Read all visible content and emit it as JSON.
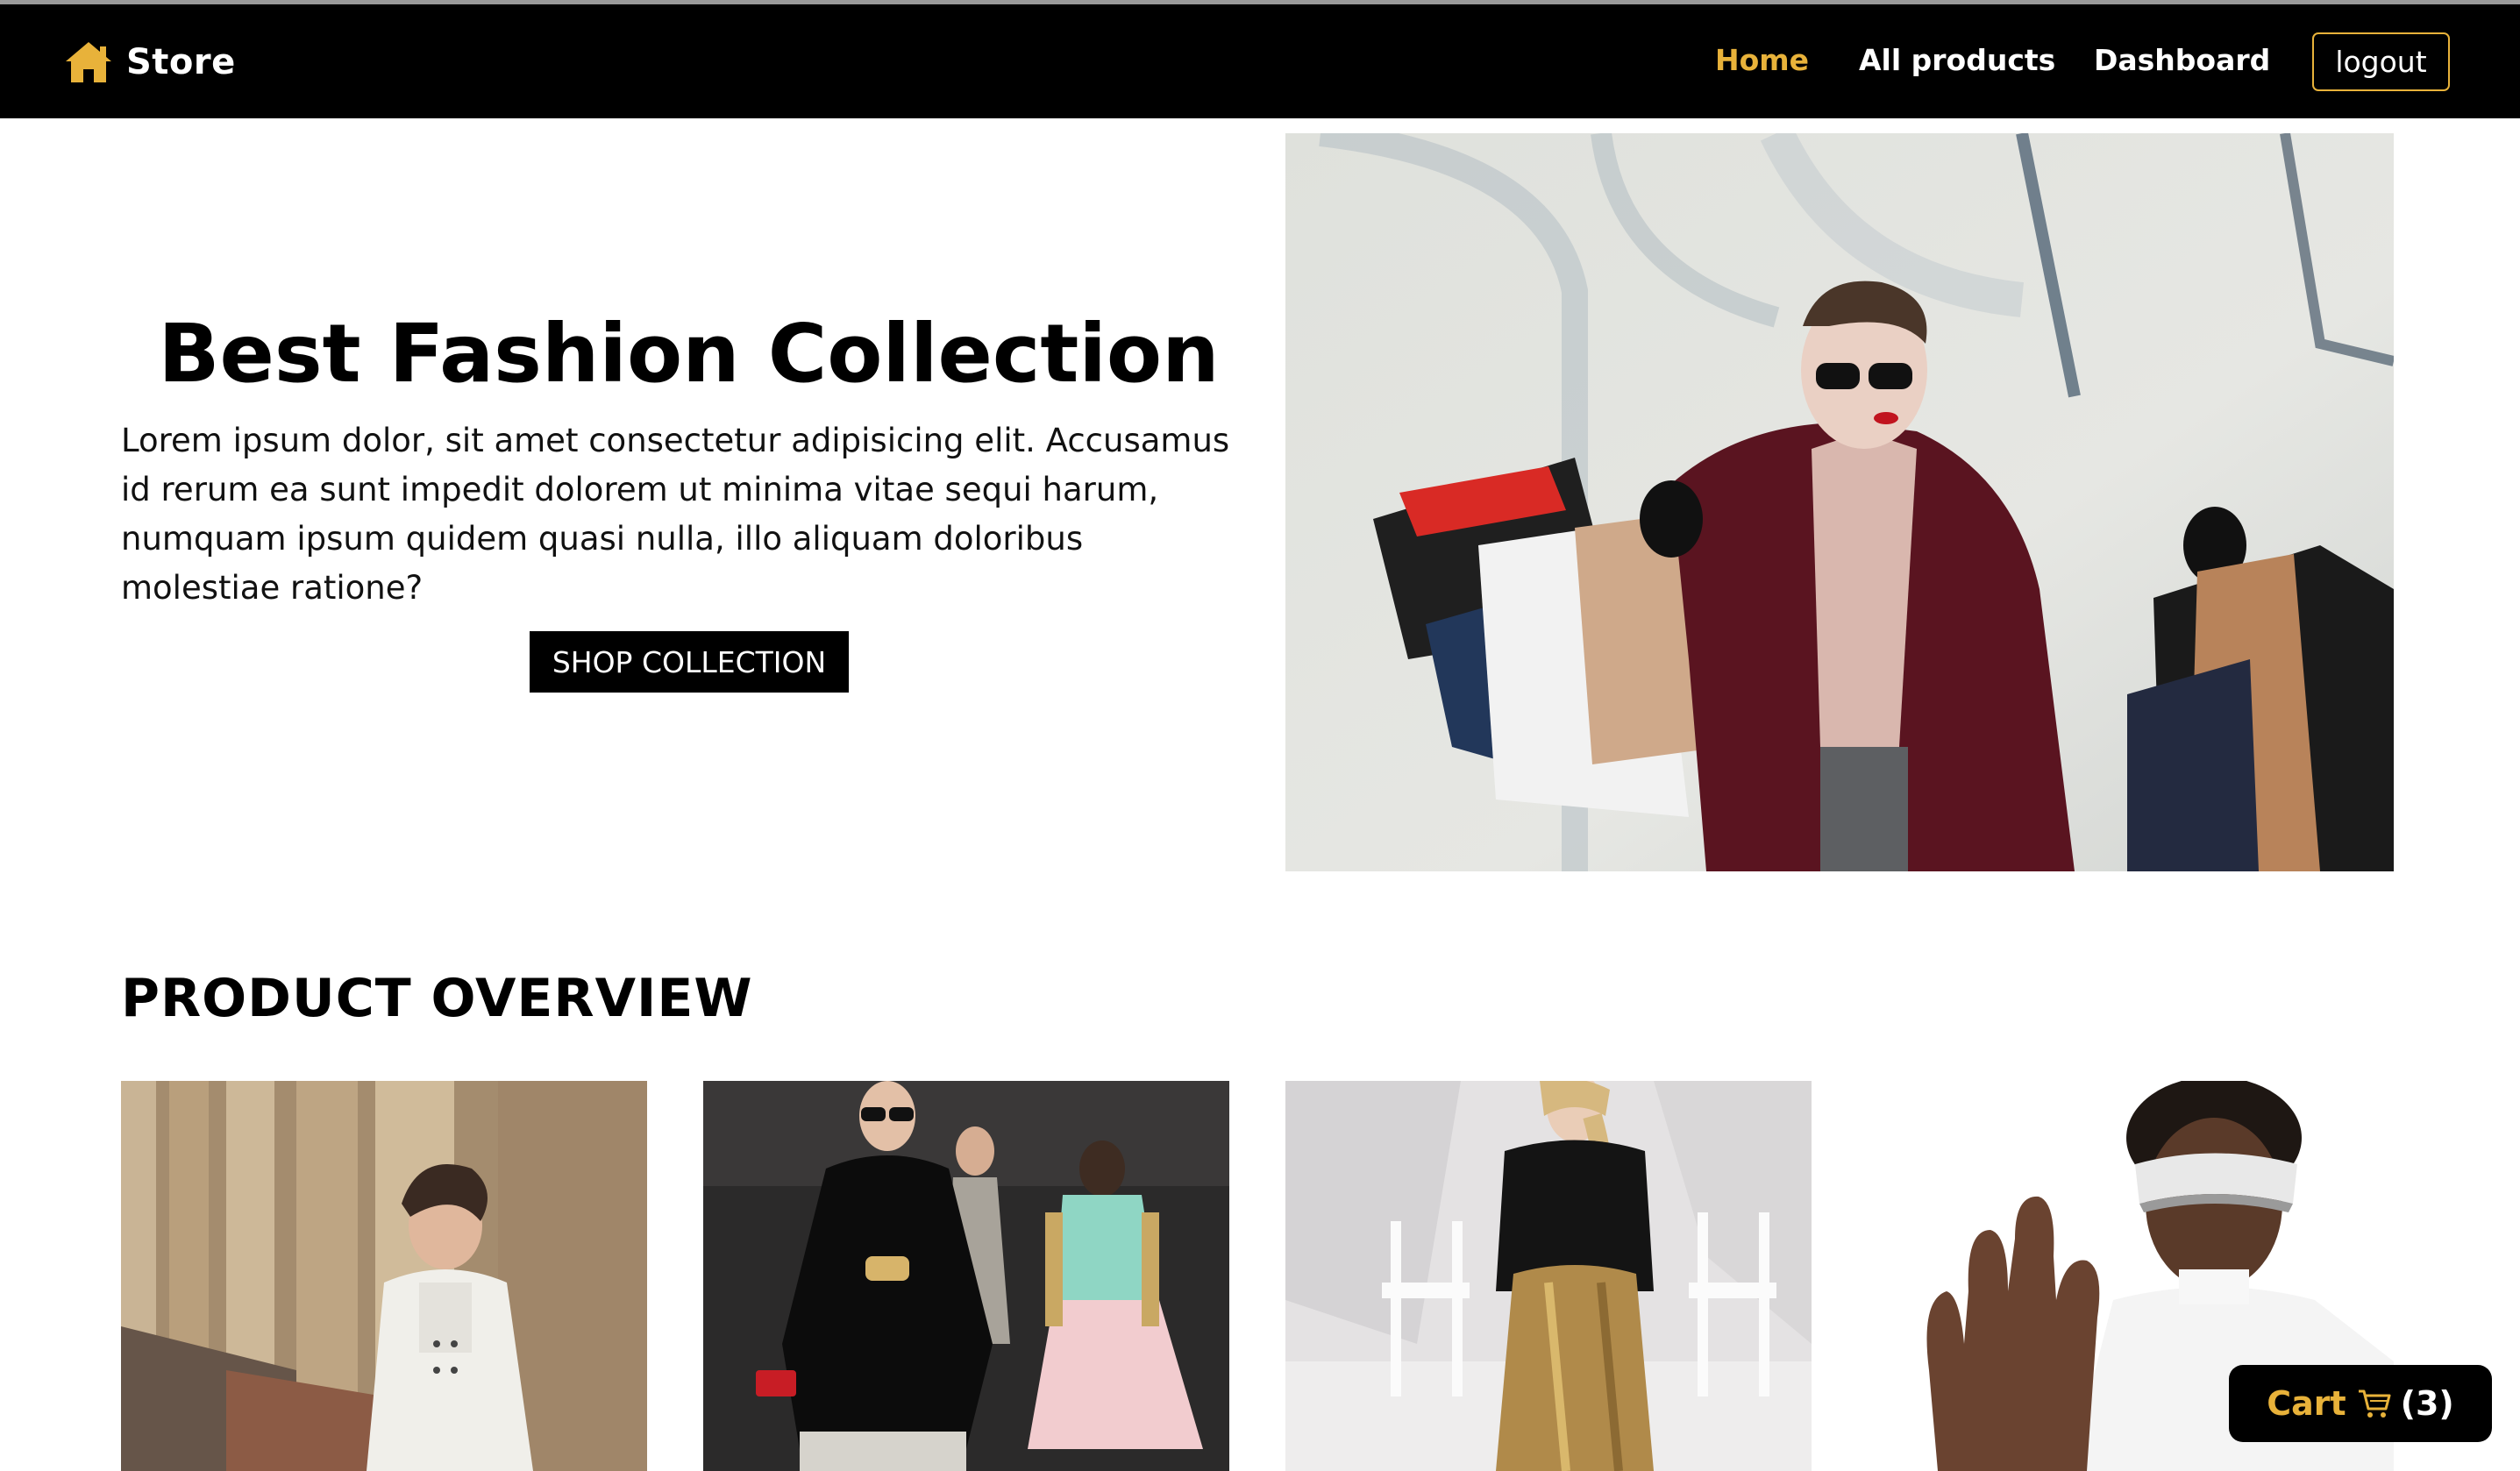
{
  "brand": {
    "name": "Store",
    "icon": "house-icon",
    "accent": "#e8b23a"
  },
  "nav": {
    "links": [
      {
        "label": "Home",
        "active": true
      },
      {
        "label": "All products",
        "active": false
      },
      {
        "label": "Dashboard",
        "active": false
      }
    ],
    "logout_label": "logout"
  },
  "hero": {
    "title": "Best Fashion Collection",
    "text": "Lorem ipsum dolor, sit amet consectetur adipisicing elit. Accusamus id rerum ea sunt impedit dolorem ut minima vitae sequi harum, numquam ipsum quidem quasi nulla, illo aliquam doloribus molestiae ratione?",
    "cta_label": "SHOP COLLECTION",
    "image": "woman-with-shopping-bags-photo"
  },
  "products": {
    "heading": "PRODUCT OVERVIEW",
    "items": [
      {
        "image": "woman-white-overalls-photo"
      },
      {
        "image": "runway-models-photo"
      },
      {
        "image": "woman-gold-trousers-photo"
      },
      {
        "image": "man-vr-headset-photo"
      }
    ]
  },
  "cart": {
    "label": "Cart",
    "icon": "cart-icon",
    "count": "(3)"
  }
}
